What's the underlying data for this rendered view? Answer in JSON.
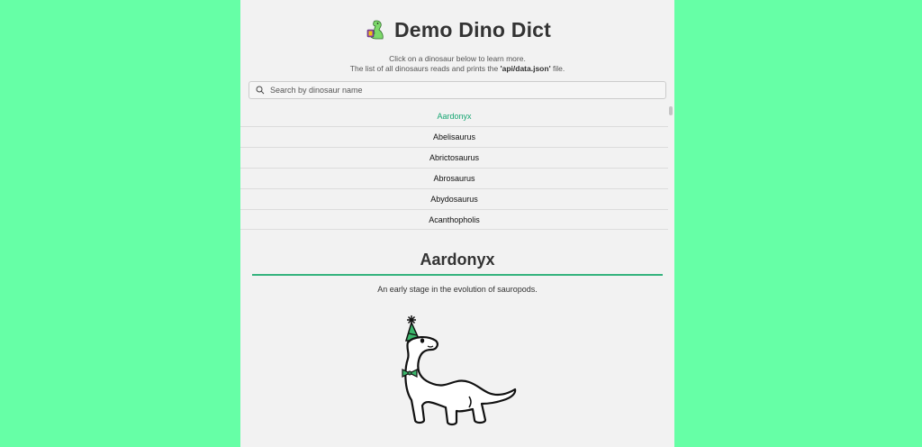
{
  "header": {
    "title": "Demo Dino Dict",
    "logo_icon": "dinosaur-logo-icon"
  },
  "intro": {
    "line1": "Click on a dinosaur below to learn more.",
    "line2_prefix": "The list of all dinosaurs reads and prints the ",
    "line2_file": "'api/data.json'",
    "line2_suffix": " file."
  },
  "search": {
    "placeholder": "Search by dinosaur name",
    "value": ""
  },
  "list": {
    "selected": "Aardonyx",
    "items": [
      "Aardonyx",
      "Abelisaurus",
      "Abrictosaurus",
      "Abrosaurus",
      "Abydosaurus",
      "Acanthopholis"
    ]
  },
  "detail": {
    "name": "Aardonyx",
    "description": "An early stage in the evolution of sauropods.",
    "image_icon": "party-dinosaur-illustration"
  },
  "colors": {
    "background": "#66ffa6",
    "panel": "#f2f2f2",
    "accent": "#35b37e",
    "active_item": "#17a673"
  }
}
